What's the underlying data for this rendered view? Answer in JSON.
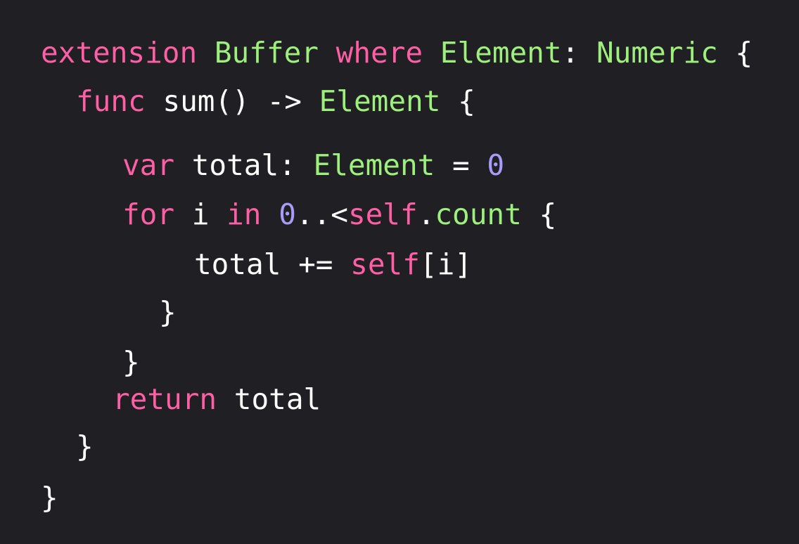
{
  "colors": {
    "background": "#1f1f24",
    "keyword": "#fc5fa3",
    "type": "#9ef07d",
    "number": "#a79df6",
    "plain": "#ffffff"
  },
  "code": {
    "lines": [
      [
        {
          "text": "extension",
          "kind": "keyword"
        },
        {
          "text": " ",
          "kind": "plain"
        },
        {
          "text": "Buffer",
          "kind": "type"
        },
        {
          "text": " ",
          "kind": "plain"
        },
        {
          "text": "where",
          "kind": "keyword"
        },
        {
          "text": " ",
          "kind": "plain"
        },
        {
          "text": "Element",
          "kind": "type"
        },
        {
          "text": ": ",
          "kind": "plain"
        },
        {
          "text": "Numeric",
          "kind": "type"
        },
        {
          "text": " {",
          "kind": "plain"
        }
      ],
      [
        {
          "text": "func",
          "kind": "keyword"
        },
        {
          "text": " sum() -> ",
          "kind": "plain"
        },
        {
          "text": "Element",
          "kind": "type"
        },
        {
          "text": " {",
          "kind": "plain"
        }
      ],
      [
        {
          "text": "var",
          "kind": "keyword"
        },
        {
          "text": " total: ",
          "kind": "plain"
        },
        {
          "text": "Element",
          "kind": "type"
        },
        {
          "text": " = ",
          "kind": "plain"
        },
        {
          "text": "0",
          "kind": "number"
        }
      ],
      [
        {
          "text": "for",
          "kind": "keyword"
        },
        {
          "text": " i ",
          "kind": "plain"
        },
        {
          "text": "in",
          "kind": "keyword"
        },
        {
          "text": " ",
          "kind": "plain"
        },
        {
          "text": "0",
          "kind": "number"
        },
        {
          "text": "..<",
          "kind": "plain"
        },
        {
          "text": "self",
          "kind": "keyword"
        },
        {
          "text": ".",
          "kind": "plain"
        },
        {
          "text": "count",
          "kind": "type"
        },
        {
          "text": " {",
          "kind": "plain"
        }
      ],
      [
        {
          "text": "total += ",
          "kind": "plain"
        },
        {
          "text": "self",
          "kind": "keyword"
        },
        {
          "text": "[i]",
          "kind": "plain"
        }
      ],
      [
        {
          "text": "}",
          "kind": "plain"
        }
      ],
      [
        {
          "text": "}",
          "kind": "plain"
        }
      ],
      [
        {
          "text": "return",
          "kind": "keyword"
        },
        {
          "text": " total",
          "kind": "plain"
        }
      ],
      [
        {
          "text": "}",
          "kind": "plain"
        }
      ],
      [
        {
          "text": "}",
          "kind": "plain"
        }
      ]
    ]
  }
}
